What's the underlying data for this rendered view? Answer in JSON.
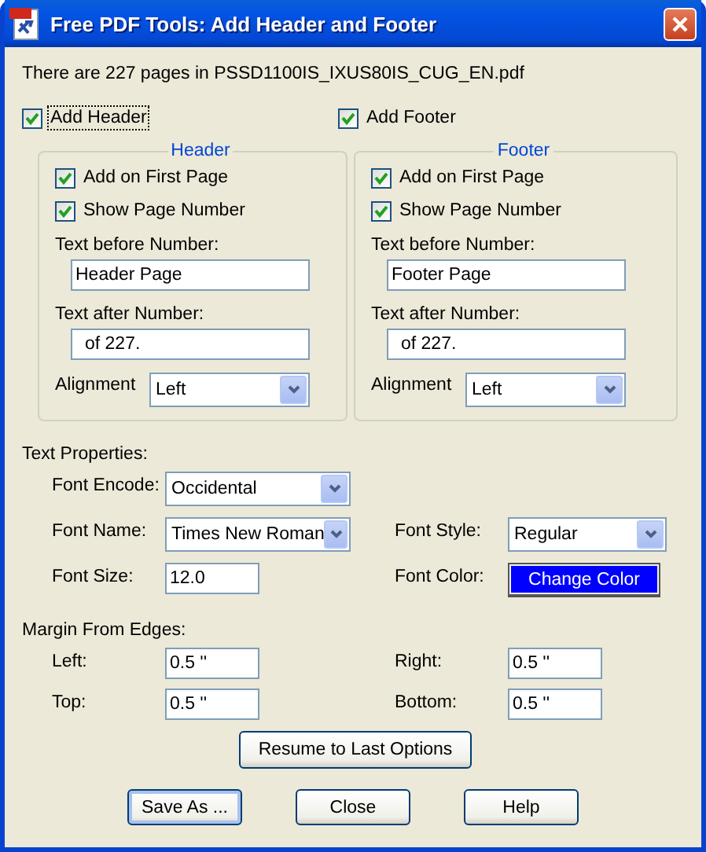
{
  "window": {
    "title": "Free PDF Tools: Add Header and Footer"
  },
  "info": "There are 227 pages in PSSD1100IS_IXUS80IS_CUG_EN.pdf",
  "sections": [
    {
      "toggle": {
        "label": "Add Header",
        "checked": true,
        "focused": true
      },
      "title": "Header",
      "options": [
        {
          "label": "Add on First Page",
          "checked": true
        },
        {
          "label": "Show Page Number",
          "checked": true
        }
      ],
      "before": {
        "label": "Text before Number:",
        "value": "Header Page"
      },
      "after": {
        "label": "Text after Number:",
        "value": "of 227."
      },
      "alignment": {
        "label": "Alignment",
        "value": "Left"
      }
    },
    {
      "toggle": {
        "label": "Add Footer",
        "checked": true,
        "focused": false
      },
      "title": "Footer",
      "options": [
        {
          "label": "Add on First Page",
          "checked": true
        },
        {
          "label": "Show Page Number",
          "checked": true
        }
      ],
      "before": {
        "label": "Text before Number:",
        "value": "Footer Page"
      },
      "after": {
        "label": "Text after Number:",
        "value": "of 227."
      },
      "alignment": {
        "label": "Alignment",
        "value": "Left"
      }
    }
  ],
  "text_properties": {
    "heading": "Text Properties:",
    "font_encode": {
      "label": "Font Encode:",
      "value": "Occidental"
    },
    "font_name": {
      "label": "Font Name:",
      "value": "Times New Roman"
    },
    "font_style": {
      "label": "Font Style:",
      "value": "Regular"
    },
    "font_size": {
      "label": "Font Size:",
      "value": "12.0"
    },
    "font_color": {
      "label": "Font Color:",
      "button": "Change Color",
      "color": "#0000ff"
    }
  },
  "margins": {
    "heading": "Margin From Edges:",
    "fields": [
      {
        "label": "Left:",
        "value": "0.5 ''"
      },
      {
        "label": "Right:",
        "value": "0.5 ''"
      },
      {
        "label": "Top:",
        "value": "0.5 ''"
      },
      {
        "label": "Bottom:",
        "value": "0.5 ''"
      }
    ]
  },
  "resume_button": "Resume to Last Options",
  "buttons": [
    {
      "label": "Save As ...",
      "default": true
    },
    {
      "label": "Close",
      "default": false
    },
    {
      "label": "Help",
      "default": false
    }
  ]
}
